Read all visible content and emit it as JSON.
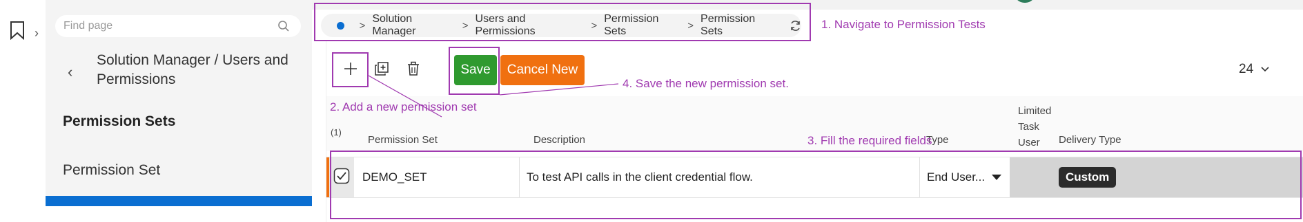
{
  "nav": {
    "search_placeholder": "Find page",
    "section_title": "Solution Manager / Users and Permissions",
    "heading": "Permission Sets",
    "item": "Permission Set"
  },
  "breadcrumb": [
    "Solution Manager",
    "Users and Permissions",
    "Permission Sets",
    "Permission Sets"
  ],
  "toolbar": {
    "save_label": "Save",
    "cancel_label": "Cancel New",
    "page_size": "24"
  },
  "table": {
    "selection_count": "(1)",
    "columns": {
      "name": "Permission Set",
      "description": "Description",
      "type": "Type",
      "limited": "Limited Task User",
      "delivery": "Delivery Type"
    },
    "rows": [
      {
        "name": "DEMO_SET",
        "description": "To test API calls in the client credential flow.",
        "type": "End User...",
        "delivery_type": "Custom"
      }
    ]
  },
  "annotations": {
    "step1": "1. Navigate to Permission Tests",
    "step2": "2. Add a new permission set",
    "step3": "3. Fill the required fields",
    "step4": "4. Save the new permission set."
  },
  "colors": {
    "annotation": "#a03ab0",
    "save": "#2f9a2f",
    "cancel": "#f07010",
    "accent": "#0a6ed1"
  }
}
